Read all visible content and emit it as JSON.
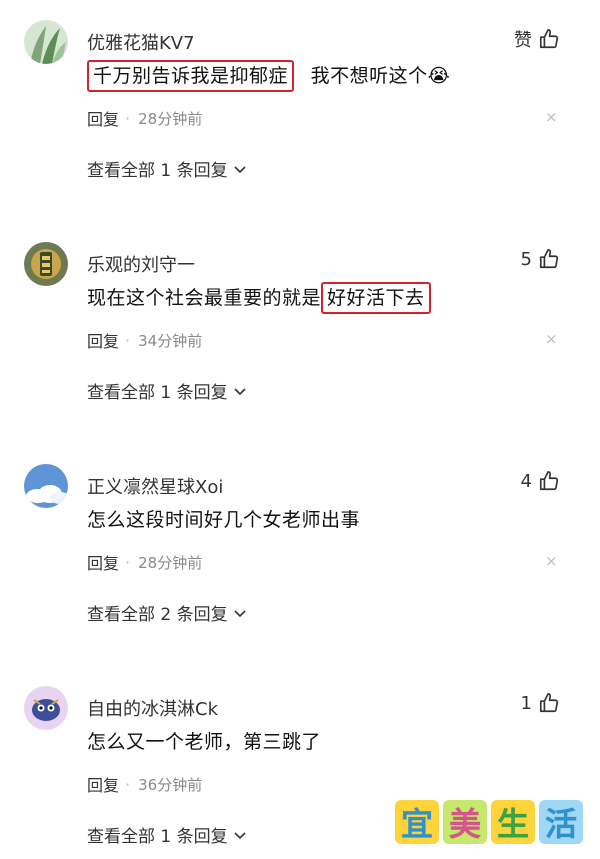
{
  "comments": [
    {
      "username": "优雅花猫KV7",
      "likes": "赞",
      "body_highlighted": "千万别告诉我是抑郁症",
      "body_plain": "我不想听这个",
      "emoji": "😭",
      "reply_label": "回复",
      "time": "28分钟前",
      "close": "×",
      "view_all": "查看全部 1 条回复"
    },
    {
      "username": "乐观的刘守一",
      "likes": "5",
      "body_plain": "现在这个社会最重要的就是",
      "body_highlighted": "好好活下去",
      "reply_label": "回复",
      "time": "34分钟前",
      "close": "×",
      "view_all": "查看全部 1 条回复"
    },
    {
      "username": "正义凛然星球Xoi",
      "likes": "4",
      "body_plain": "怎么这段时间好几个女老师出事",
      "reply_label": "回复",
      "time": "28分钟前",
      "close": "×",
      "view_all": "查看全部 2 条回复"
    },
    {
      "username": "自由的冰淇淋Ck",
      "likes": "1",
      "body_plain": "怎么又一个老师，第三跳了",
      "reply_label": "回复",
      "time": "36分钟前",
      "close": "×",
      "view_all": "查看全部 1 条回复"
    }
  ],
  "watermark": [
    "宜",
    "美",
    "生",
    "活"
  ],
  "colors": {
    "highlight_border": "#d2232a",
    "watermark_bg": [
      "#ffd43a",
      "#c7e86a",
      "#ffd43a",
      "#9ed8f5"
    ],
    "watermark_fg": [
      "#2f9ee0",
      "#e85a9a",
      "#3cae4e",
      "#2f9ee0"
    ]
  },
  "icons": {
    "like": "thumbs-up-icon",
    "chevron": "chevron-down-icon",
    "close": "close-icon"
  }
}
